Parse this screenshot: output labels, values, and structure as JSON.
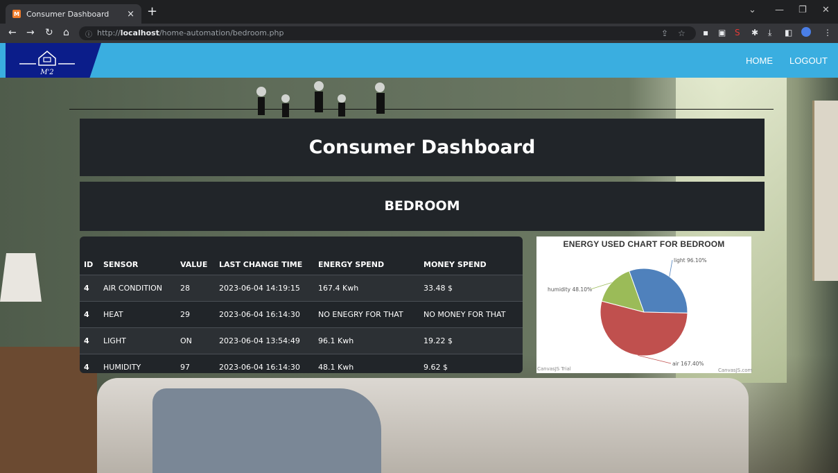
{
  "browser": {
    "tab_title": "Consumer Dashboard",
    "tab_favicon_text": "M",
    "tab_close": "×",
    "new_tab": "+",
    "url_scheme_host_prefix": "http://",
    "url_host": "localhost",
    "url_path": "/home-automation/bedroom.php"
  },
  "header": {
    "logo_text": "M'2",
    "nav": [
      {
        "label": "HOME"
      },
      {
        "label": "LOGOUT"
      }
    ]
  },
  "dashboard": {
    "title": "Consumer Dashboard",
    "room_name": "BEDROOM"
  },
  "table": {
    "headers": [
      "ID",
      "SENSOR",
      "VALUE",
      "LAST CHANGE TIME",
      "ENERGY SPEND",
      "MONEY SPEND"
    ],
    "rows": [
      {
        "id": "4",
        "sensor": "AIR CONDITION",
        "value": "28",
        "time": "2023-06-04 14:19:15",
        "energy": "167.4 Kwh",
        "money": "33.48 $"
      },
      {
        "id": "4",
        "sensor": "HEAT",
        "value": "29",
        "time": "2023-06-04 16:14:30",
        "energy": "NO ENEGRY FOR THAT",
        "money": "NO MONEY FOR THAT"
      },
      {
        "id": "4",
        "sensor": "LIGHT",
        "value": "ON",
        "time": "2023-06-04 13:54:49",
        "energy": "96.1 Kwh",
        "money": "19.22 $"
      },
      {
        "id": "4",
        "sensor": "HUMIDITY",
        "value": "97",
        "time": "2023-06-04 16:14:30",
        "energy": "48.1 Kwh",
        "money": "9.62 $"
      }
    ]
  },
  "chart": {
    "credit_left": "CanvasJS Trial",
    "credit_right": "CanvasJS.com"
  },
  "chart_data": {
    "type": "pie",
    "title": "ENERGY USED CHART FOR BEDROOM",
    "slices": [
      {
        "label": "light",
        "value": 96.1,
        "display": "light 96.10%",
        "color": "#4f81bc"
      },
      {
        "label": "air",
        "value": 167.4,
        "display": "air 167.40%",
        "color": "#c0504e"
      },
      {
        "label": "humidity",
        "value": 48.1,
        "display": "humidity 48.10%",
        "color": "#9bbb58"
      }
    ]
  },
  "colors": {
    "header": "#3aaee0",
    "logo_bg": "#0b1d8a",
    "panel": "#212529"
  }
}
